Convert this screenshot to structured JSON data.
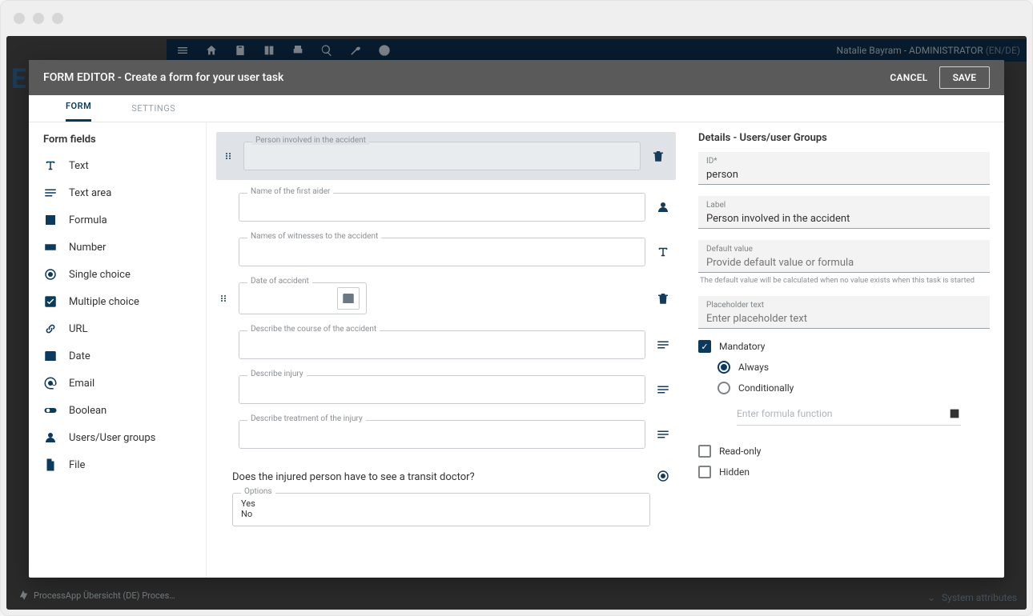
{
  "chrome": {},
  "bg": {
    "user_name": "Natalie Bayram",
    "user_role": "ADMINISTRATOR",
    "user_locale": "(EN/DE)",
    "logo_letter": "E",
    "breadcrumb": "ProcessApp Übersicht (DE) Proces…",
    "system_attributes": "System attributes"
  },
  "modal": {
    "title_prefix": "FORM EDITOR",
    "title_suffix": "Create a form for your user task",
    "cancel": "CANCEL",
    "save": "SAVE"
  },
  "tabs": {
    "form": "FORM",
    "settings": "SETTINGS"
  },
  "fields_panel": {
    "heading": "Form fields",
    "items": {
      "text": "Text",
      "textarea": "Text area",
      "formula": "Formula",
      "number": "Number",
      "single": "Single choice",
      "multiple": "Multiple choice",
      "url": "URL",
      "date": "Date",
      "email": "Email",
      "boolean": "Boolean",
      "users": "Users/User groups",
      "file": "File"
    }
  },
  "canvas": {
    "person": "Person involved in the accident",
    "first_aider": "Name of the first aider",
    "witnesses": "Names of witnesses to the accident",
    "date": "Date of accident",
    "course": "Describe the course of the accident",
    "injury": "Describe injury",
    "treatment": "Describe treatment of the injury",
    "question": "Does the injured person have to see a transit doctor?",
    "options_label": "Options",
    "options_yes": "Yes",
    "options_no": "No"
  },
  "details": {
    "heading": "Details - Users/user Groups",
    "id_label": "ID*",
    "id_value": "person",
    "label_label": "Label",
    "label_value": "Person involved in the accident",
    "default_label": "Default value",
    "default_placeholder": "Provide default value or formula",
    "default_hint": "The default value will be calculated when no value exists when this task is started",
    "placeholder_label": "Placeholder text",
    "placeholder_placeholder": "Enter placeholder text",
    "mandatory": "Mandatory",
    "always": "Always",
    "conditionally": "Conditionally",
    "formula_placeholder": "Enter formula function",
    "readonly": "Read-only",
    "hidden": "Hidden"
  }
}
